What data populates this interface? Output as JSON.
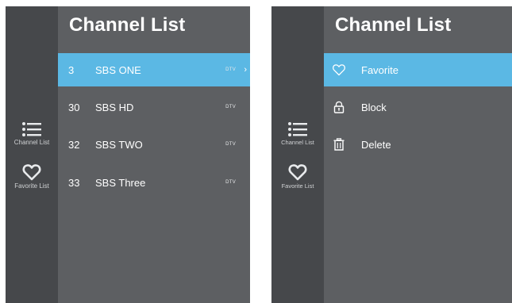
{
  "left_panel": {
    "title": "Channel List",
    "rail": {
      "channel_list_label": "Channel List",
      "favorite_list_label": "Favorite List"
    },
    "channels": [
      {
        "number": "3",
        "name": "SBS ONE",
        "type": "DTV",
        "selected": true
      },
      {
        "number": "30",
        "name": "SBS HD",
        "type": "DTV",
        "selected": false
      },
      {
        "number": "32",
        "name": "SBS TWO",
        "type": "DTV",
        "selected": false
      },
      {
        "number": "33",
        "name": "SBS Three",
        "type": "DTV",
        "selected": false
      }
    ],
    "arrow": "›"
  },
  "right_panel": {
    "title": "Channel List",
    "rail": {
      "channel_list_label": "Channel List",
      "favorite_list_label": "Favorite List"
    },
    "menu": [
      {
        "label": "Favorite",
        "icon": "heart-icon",
        "selected": true
      },
      {
        "label": "Block",
        "icon": "lock-icon",
        "selected": false
      },
      {
        "label": "Delete",
        "icon": "trash-icon",
        "selected": false
      }
    ]
  },
  "colors": {
    "panel_bg": "#5d5f62",
    "rail_bg": "#46484b",
    "highlight": "#5bb8e4",
    "text": "#ffffff"
  }
}
